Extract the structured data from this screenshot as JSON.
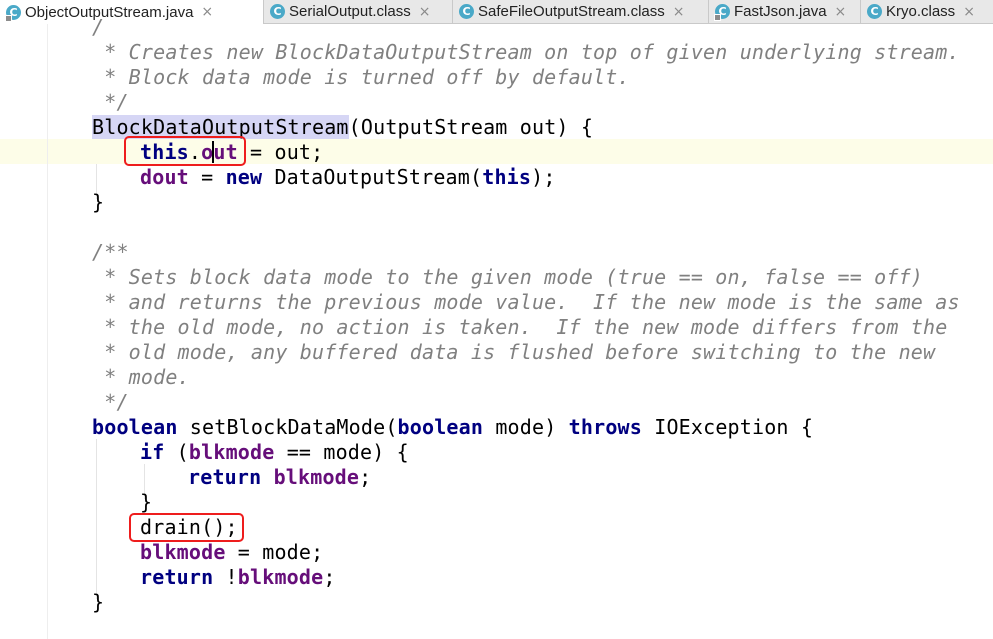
{
  "tabs": [
    {
      "label": "ObjectOutputStream.java",
      "active": true,
      "icon": "java-class-icon"
    },
    {
      "label": "SerialOutput.class",
      "active": false,
      "icon": "class-file-icon"
    },
    {
      "label": "SafeFileOutputStream.class",
      "active": false,
      "icon": "class-file-icon"
    },
    {
      "label": "FastJson.java",
      "active": false,
      "icon": "java-class-icon"
    },
    {
      "label": "Kryo.class",
      "active": false,
      "icon": "class-file-icon"
    }
  ],
  "tab_icon_glyph": "C",
  "tab_close_glyph": "×",
  "code": {
    "l0": "/",
    "l1": " * Creates new BlockDataOutputStream on top of given underlying stream.",
    "l2": " * Block data mode is turned off by default.",
    "l3": " */",
    "l4_ctor": "BlockDataOutputStream",
    "l4_rest": "(OutputStream out) {",
    "l5_this": "this",
    "l5_dot": ".",
    "l5_fa": "o",
    "l5_fb": "ut",
    "l5_rest": " = out;",
    "l6_field": "dout",
    "l6_eq": " = ",
    "l6_new": "new",
    "l6_mid": " DataOutputStream(",
    "l6_this": "this",
    "l6_end": ");",
    "l7": "}",
    "l9": "/**",
    "l10": " * Sets block data mode to the given mode (true == on, false == off)",
    "l11": " * and returns the previous mode value.  If the new mode is the same as",
    "l12": " * the old mode, no action is taken.  If the new mode differs from the",
    "l13": " * old mode, any buffered data is flushed before switching to the new",
    "l14": " * mode.",
    "l15": " */",
    "l16_bool1": "boolean",
    "l16_mid": " setBlockDataMode(",
    "l16_bool2": "boolean",
    "l16_mode": " mode) ",
    "l16_throws": "throws",
    "l16_end": " IOException {",
    "l17_if": "if",
    "l17_paren": " (",
    "l17_field": "blkmode",
    "l17_end": " == mode) {",
    "l18_return": "return",
    "l18_sp": " ",
    "l18_field": "blkmode",
    "l18_end": ";",
    "l19": "}",
    "l20": "drain();",
    "l21_field": "blkmode",
    "l21_end": " = mode;",
    "l22_return": "return",
    "l22_not": " !",
    "l22_field": "blkmode",
    "l22_end": ";",
    "l23": "}"
  },
  "colors": {
    "keyword": "#000080",
    "field": "#660e7a",
    "comment": "#808080",
    "annotation_box": "#ee1d1d"
  }
}
